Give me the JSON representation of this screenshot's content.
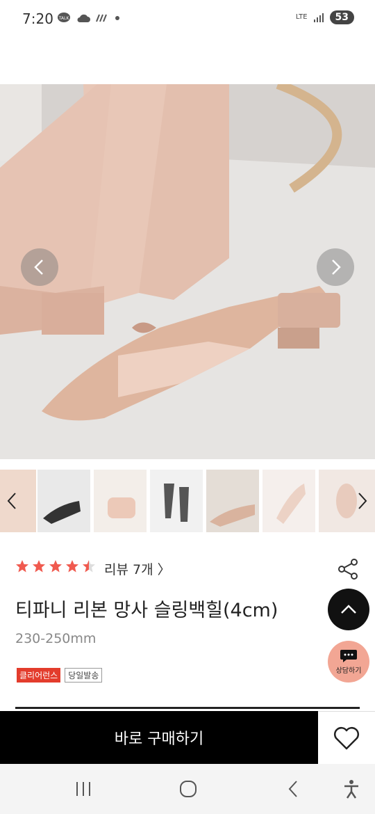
{
  "status_bar": {
    "time": "7:20",
    "network": "LTE",
    "battery": "53",
    "icons": [
      "talk-icon",
      "cloud-icon",
      "signal-dots-icon",
      "dot-icon"
    ]
  },
  "gallery": {
    "prev_icon": "chevron-left-icon",
    "next_icon": "chevron-right-icon"
  },
  "product": {
    "rating": 4.5,
    "review_label": "리뷰 7개 〉",
    "title": "티파니 리본 망사 슬링백힐(4cm)",
    "size_range": "230-250mm",
    "badges": [
      "클리어런스",
      "당일발송"
    ]
  },
  "fab": {
    "chat_label": "상담하기"
  },
  "bottom_bar": {
    "buy_label": "바로 구매하기"
  },
  "colors": {
    "accent_red": "#e33c2c",
    "star": "#f05a4f",
    "chat_fab": "#f2a694"
  }
}
